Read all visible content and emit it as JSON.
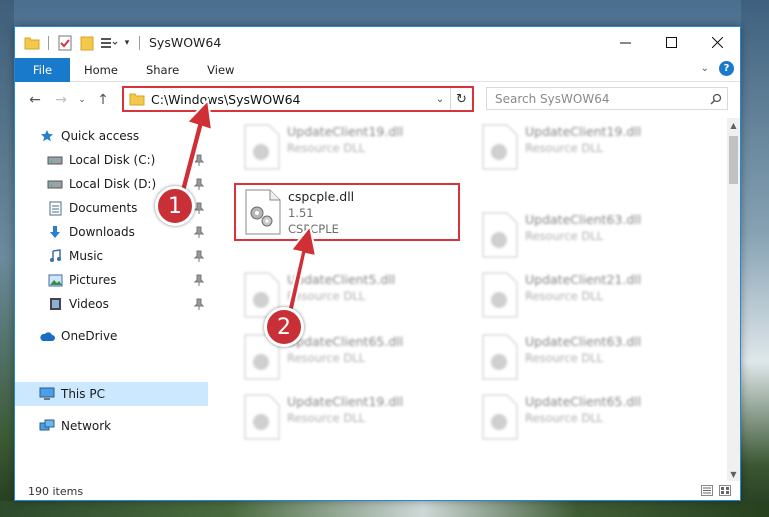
{
  "window": {
    "title": "SysWOW64"
  },
  "ribbon": {
    "tabs": [
      "File",
      "Home",
      "Share",
      "View"
    ]
  },
  "address": {
    "path": "C:\\Windows\\SysWOW64"
  },
  "search": {
    "placeholder": "Search SysWOW64"
  },
  "sidebar": {
    "items": [
      {
        "label": "Quick access",
        "icon": "star-icon"
      },
      {
        "label": "Local Disk (C:)",
        "icon": "drive-icon"
      },
      {
        "label": "Local Disk (D:)",
        "icon": "drive-icon"
      },
      {
        "label": "Documents",
        "icon": "documents-icon"
      },
      {
        "label": "Downloads",
        "icon": "download-arrow-icon"
      },
      {
        "label": "Music",
        "icon": "music-note-icon"
      },
      {
        "label": "Pictures",
        "icon": "pictures-icon"
      },
      {
        "label": "Videos",
        "icon": "film-icon"
      },
      {
        "label": "OneDrive",
        "icon": "cloud-icon"
      },
      {
        "label": "This PC",
        "icon": "monitor-icon"
      },
      {
        "label": "Network",
        "icon": "network-icon"
      }
    ]
  },
  "files": [
    {
      "name": "UpdateClient19.dll",
      "sub": "Resource DLL"
    },
    {
      "name": "UpdateClient19.dll",
      "sub": "Resource DLL"
    },
    {
      "name": "UpdateClient63.dll",
      "sub": "Resource DLL"
    },
    {
      "name": "UpdateClient5.dll",
      "sub": "Resource DLL"
    },
    {
      "name": "UpdateClient21.dll",
      "sub": "Resource DLL"
    },
    {
      "name": "UpdateClient65.dll",
      "sub": "Resource DLL"
    },
    {
      "name": "UpdateClient63.dll",
      "sub": "Resource DLL"
    },
    {
      "name": "UpdateClient19.dll",
      "sub": "Resource DLL"
    },
    {
      "name": "UpdateClient65.dll",
      "sub": "Resource DLL"
    }
  ],
  "focused_file": {
    "name": "cspcple.dll",
    "version": "1.51",
    "description": "CSPCPLE"
  },
  "status": {
    "item_count": "190 items"
  },
  "callouts": {
    "one": "1",
    "two": "2"
  },
  "colors": {
    "accent": "#1979ca",
    "highlight": "#d9343b",
    "selection": "#cce8ff"
  }
}
